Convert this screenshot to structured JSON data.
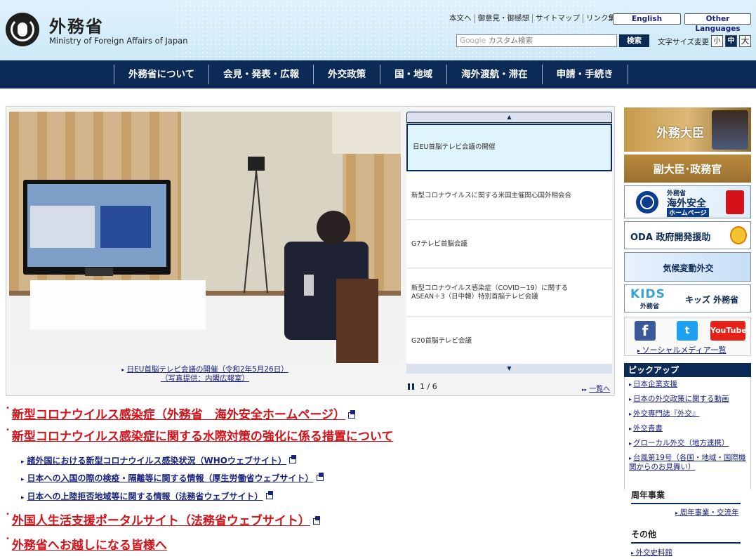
{
  "header": {
    "logo_ja": "外務省",
    "logo_en": "Ministry of Foreign Affairs of Japan",
    "util_links": [
      "本文へ",
      "御意見・御感想",
      "サイトマップ",
      "リンク集"
    ],
    "lang_english": "English",
    "lang_other": "Other Languages",
    "search_google": "Google",
    "search_placeholder": "カスタム検索",
    "search_button": "検索",
    "fontsize_label": "文字サイズ変更",
    "fontsize_small": "小",
    "fontsize_medium": "中",
    "fontsize_large": "大"
  },
  "nav": [
    "外務省について",
    "会見・発表・広報",
    "外交政策",
    "国・地域",
    "海外渡航・滞在",
    "申請・手続き"
  ],
  "slider": {
    "caption_line1": "日EU首脳テレビ会議の開催（令和2年5月26日）",
    "caption_line2": "（写真提供：内閣広報室）",
    "items": [
      "日EU首脳テレビ会議の開催",
      "新型コロナウイルスに関する米国主催関心国外相会合",
      "G7テレビ首脳会議",
      "新型コロナウイルス感染症（COVID－19）に関する\nASEAN＋3（日中韓）特別首脳テレビ会議",
      "G20首脳テレビ会議"
    ],
    "pager": "1 / 6",
    "list_link": "一覧へ"
  },
  "news": {
    "big1": "新型コロナウイルス感染症（外務省　海外安全ホームページ）",
    "big2": "新型コロナウイルス感染症に関する水際対策の強化に係る措置について",
    "sub": [
      "諸外国における新型コロナウイルス感染状況（WHOウェブサイト）",
      "日本への入国の際の検疫・隔離等に関する情報（厚生労働省ウェブサイト）",
      "日本への上陸拒否地域等に関する情報（法務省ウェブサイト）"
    ],
    "big3": "外国人生活支援ポータルサイト（法務省ウェブサイト）",
    "big4": "外務省へお越しになる皆様へ"
  },
  "sidebar": {
    "minister": "外務大臣",
    "vice": "副大臣･政務官",
    "safety_line1": "外務省",
    "safety_line2": "海外安全",
    "safety_line3": "ホームページ",
    "oda": "ODA 政府開発援助",
    "climate": "気候変動外交",
    "kids_logo": "KIDS",
    "kids_sub": "外務省",
    "kids_label": "キッズ 外務省",
    "social_fb": "f",
    "social_tw": "t",
    "social_yt": "YouTube",
    "social_link": "ソーシャルメディア一覧",
    "pickup_title": "ピックアップ",
    "pickup": [
      "日本企業支援",
      "日本の外交政策に関する動画",
      "外交専門誌『外交』",
      "外交青書",
      "グローカル外交（地方連携）",
      "台風第19号（各国・地域・国際機関からのお見舞い）"
    ],
    "anniversary_title": "周年事業",
    "anniversary_link": "周年事業・交流年",
    "other_title": "その他",
    "other_link": "外交史料館"
  }
}
